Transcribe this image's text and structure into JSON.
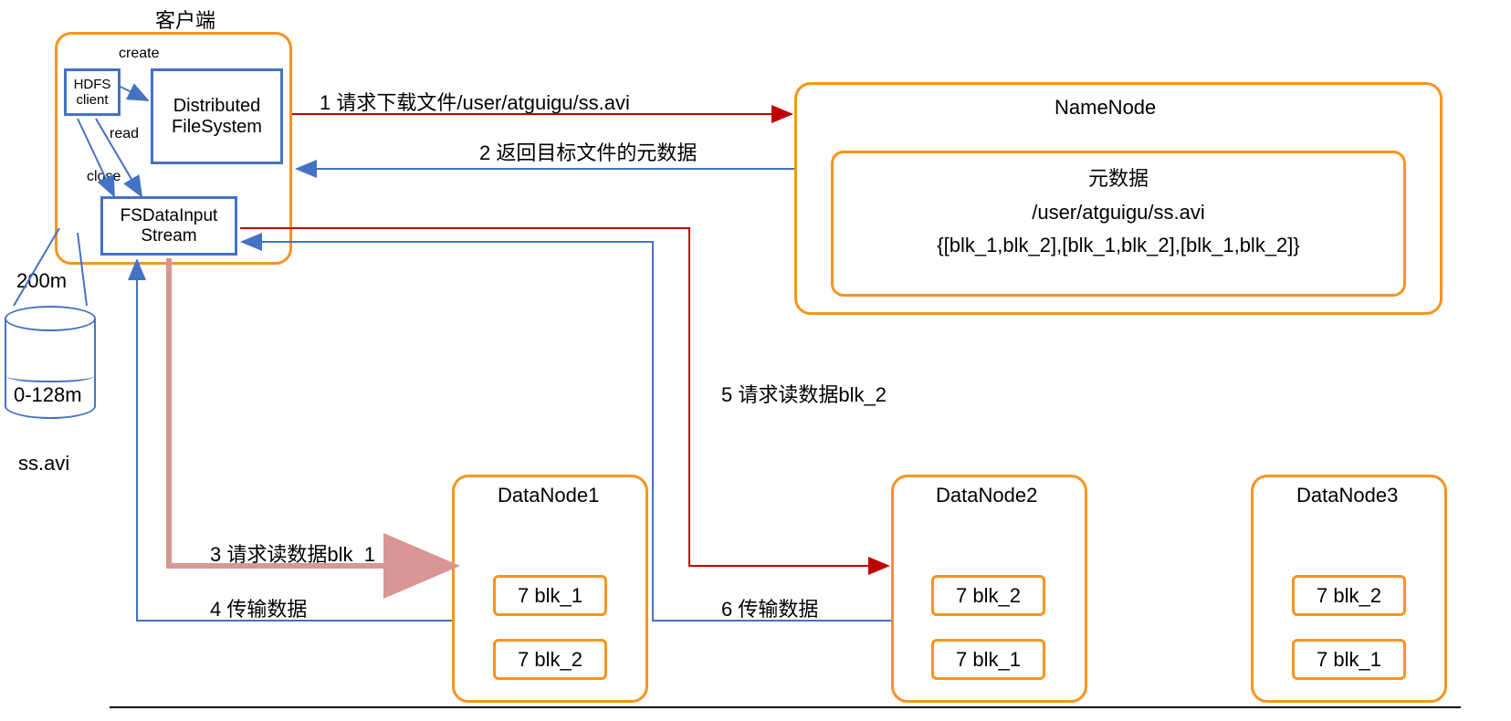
{
  "client": {
    "title": "客户端",
    "hdfs_client": "HDFS\nclient",
    "dfs": "Distributed\nFileSystem",
    "fsdata": "FSDataInput\nStream",
    "create": "create",
    "read": "read",
    "close": "close"
  },
  "file": {
    "size": "200m",
    "range": "0-128m",
    "name": "ss.avi"
  },
  "namenode": {
    "title": "NameNode",
    "meta_title": "元数据",
    "path": "/user/atguigu/ss.avi",
    "blocks": "{[blk_1,blk_2],[blk_1,blk_2],[blk_1,blk_2]}"
  },
  "datanodes": {
    "dn1": {
      "title": "DataNode1",
      "b1": "7 blk_1",
      "b2": "7 blk_2"
    },
    "dn2": {
      "title": "DataNode2",
      "b1": "7 blk_2",
      "b2": "7 blk_1"
    },
    "dn3": {
      "title": "DataNode3",
      "b1": "7 blk_2",
      "b2": "7 blk_1"
    }
  },
  "steps": {
    "s1": "1 请求下载文件/user/atguigu/ss.avi",
    "s2": "2 返回目标文件的元数据",
    "s3": "3 请求读数据blk_1",
    "s4": "4 传输数据",
    "s5": "5 请求读数据blk_2",
    "s6": "6 传输数据"
  }
}
